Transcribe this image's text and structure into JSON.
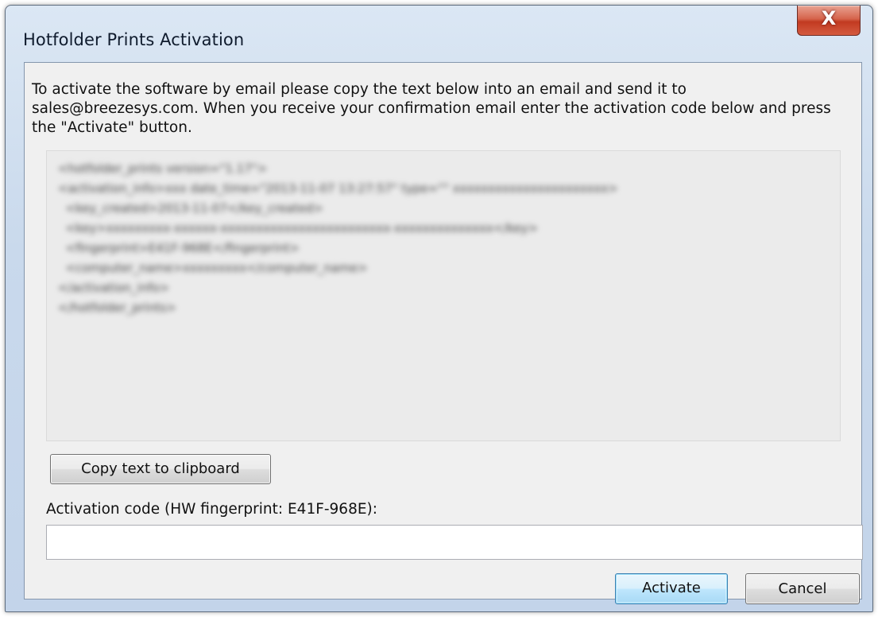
{
  "window": {
    "title": "Hotfolder Prints Activation",
    "close_glyph": "X"
  },
  "dialog": {
    "instructions": "To activate the software by email please copy the text below into an email and send it to sales@breezesys.com. When you receive your confirmation email enter the activation code below and press the \"Activate\" button.",
    "activation_request_text": "<hotfolder_prints version=\"1.17\">\n<activation_info>xxx date_time=\"2013-11-07 13:27:57\" type=\"\" xxxxxxxxxxxxxxxxxxxxxx>\n  <key_created>2013-11-07</key_created>\n  <key>xxxxxxxxx-xxxxxx-xxxxxxxxxxxxxxxxxxxxxxxx-xxxxxxxxxxxxxx</key>\n  <fingerprint>E41F-968E</fingerprint>\n  <computer_name>xxxxxxxxx</computer_name>\n</activation_info>\n</hotfolder_prints>",
    "copy_button_label": "Copy text to clipboard",
    "activation_code_label": "Activation code (HW fingerprint: E41F-968E):",
    "activation_code_value": "",
    "activate_button_label": "Activate",
    "cancel_button_label": "Cancel"
  },
  "colors": {
    "client_background": "#f0f0f0",
    "default_button_border": "#3c7fb1",
    "close_button": "#c23a21"
  },
  "icons": {
    "close": "close-icon"
  }
}
